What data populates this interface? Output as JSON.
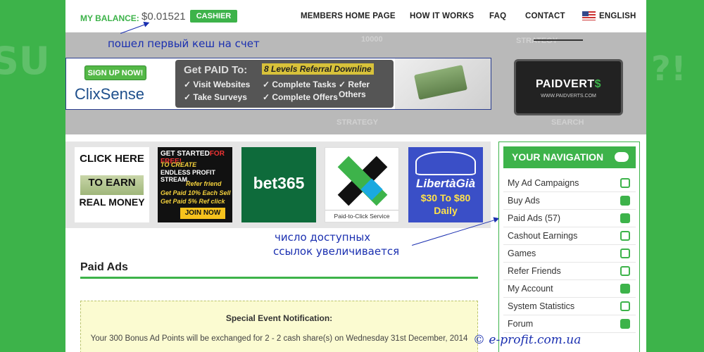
{
  "header": {
    "balance_label": "MY BALANCE:",
    "balance_value": "$0.01521",
    "cashier_label": "CASHIER",
    "nav": [
      "MEMBERS HOME PAGE",
      "HOW IT WORKS",
      "FAQ",
      "CONTACT"
    ],
    "language": "ENGLISH"
  },
  "annotations": {
    "first_cash": "пошел первый кеш на счет",
    "links_line1": "число доступных",
    "links_line2": "ссылок увеличивается",
    "watermark": "© e-profit.com.ua"
  },
  "banner": {
    "signup": "SIGN UP NOW!",
    "clixsense": "ClixSense",
    "get_paid": "Get PAID To:",
    "levels": "8 Levels Referral Downline",
    "perks": [
      "✓ Visit Websites",
      "✓ Complete Tasks",
      "✓ Refer Others",
      "✓ Take Surveys",
      "✓ Complete Offers"
    ],
    "paidverts_prefix": "PAIDVERT",
    "paidverts_suffix": "$",
    "paidverts_url": "WWW.PAIDVERTS.COM"
  },
  "ads": {
    "ad1": [
      "CLICK HERE",
      "TO EARN",
      "REAL MONEY"
    ],
    "ad2": {
      "head": "GET STARTED",
      "head_red": "FOR FREE!",
      "l1": "TO CREATE",
      "l2": "ENDLESS PROFIT STREAM.",
      "l3": "Refer friend",
      "l4": "Get Paid 10% Each Sell",
      "l5": "Get Paid 5% Ref click",
      "join": "JOIN NOW"
    },
    "ad3": "bet365",
    "ad4_caption": "Paid-to-Click Service",
    "ad5": [
      "LibertàGià",
      "$30 To $80",
      "Daily"
    ]
  },
  "content": {
    "section_title": "Paid Ads",
    "notice_title": "Special Event Notification:",
    "notice_body": "Your 300 Bonus Ad Points will be exchanged for 2 - 2 cash share(s) on Wednesday 31st December, 2014"
  },
  "sidebar": {
    "title": "YOUR NAVIGATION",
    "items": [
      {
        "label": "My Ad Campaigns",
        "icon": "share-icon"
      },
      {
        "label": "Buy Ads",
        "icon": "cash-icon"
      },
      {
        "label": "Paid Ads (57)",
        "icon": "folder-share-icon"
      },
      {
        "label": "Cashout Earnings",
        "icon": "money-bag-icon"
      },
      {
        "label": "Games",
        "icon": "dice-icon"
      },
      {
        "label": "Refer Friends",
        "icon": "sitemap-icon"
      },
      {
        "label": "My Account",
        "icon": "user-icon"
      },
      {
        "label": "System Statistics",
        "icon": "chart-icon"
      },
      {
        "label": "Forum",
        "icon": "list-icon"
      }
    ]
  },
  "colors": {
    "brand_green": "#3db34a",
    "annotation_blue": "#1a2fb0"
  }
}
